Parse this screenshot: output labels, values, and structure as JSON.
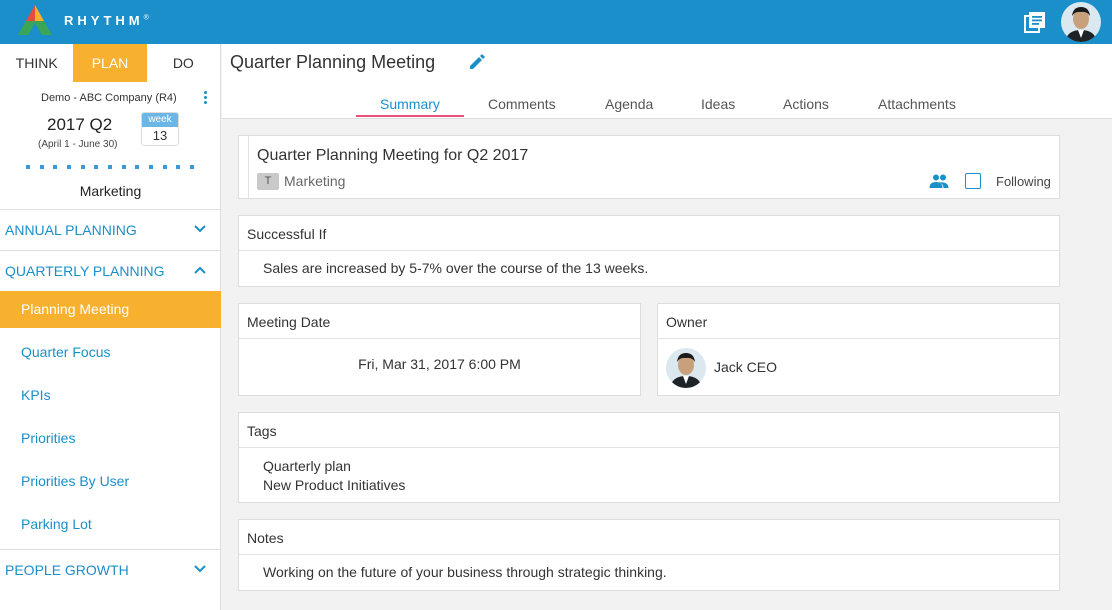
{
  "app": {
    "brand": "RHYTHM",
    "brand_mark": "®"
  },
  "colors": {
    "topbar": "#1a8fc9",
    "accent_orange": "#f7b12f",
    "link_blue": "#1a8fc9",
    "tab_underline": "#e8507a"
  },
  "topbar": {
    "library_icon": "library-books-icon",
    "avatar": "user-avatar"
  },
  "modes": [
    {
      "label": "THINK",
      "active": false
    },
    {
      "label": "PLAN",
      "active": true
    },
    {
      "label": "DO",
      "active": false
    }
  ],
  "context": {
    "company": "Demo - ABC Company (R4)",
    "quarter": "2017 Q2",
    "range": "(April 1 - June 30)",
    "week_label": "week",
    "week_num": "13",
    "team": "Marketing"
  },
  "sections": {
    "annual": "ANNUAL PLANNING",
    "quarterly": "QUARTERLY PLANNING",
    "people": "PEOPLE GROWTH"
  },
  "nav": [
    {
      "label": "Planning Meeting",
      "active": true
    },
    {
      "label": "Quarter Focus",
      "active": false
    },
    {
      "label": "KPIs",
      "active": false
    },
    {
      "label": "Priorities",
      "active": false
    },
    {
      "label": "Priorities By User",
      "active": false
    },
    {
      "label": "Parking Lot",
      "active": false
    }
  ],
  "header": {
    "title": "Quarter Planning Meeting"
  },
  "tabs": [
    "Summary",
    "Comments",
    "Agenda",
    "Ideas",
    "Actions",
    "Attachments"
  ],
  "meeting": {
    "name": "Quarter Planning Meeting for Q2 2017",
    "team_badge": "T",
    "team": "Marketing",
    "following_label": "Following"
  },
  "successful_if": {
    "heading": "Successful If",
    "text": "Sales are increased by 5-7% over the course of the 13 weeks."
  },
  "meeting_date": {
    "heading": "Meeting Date",
    "value": "Fri, Mar 31, 2017 6:00 PM"
  },
  "owner": {
    "heading": "Owner",
    "name": "Jack CEO"
  },
  "tags": {
    "heading": "Tags",
    "items": [
      "Quarterly plan",
      "New Product Initiatives"
    ]
  },
  "notes": {
    "heading": "Notes",
    "text": "Working on the future of your business through strategic thinking."
  }
}
